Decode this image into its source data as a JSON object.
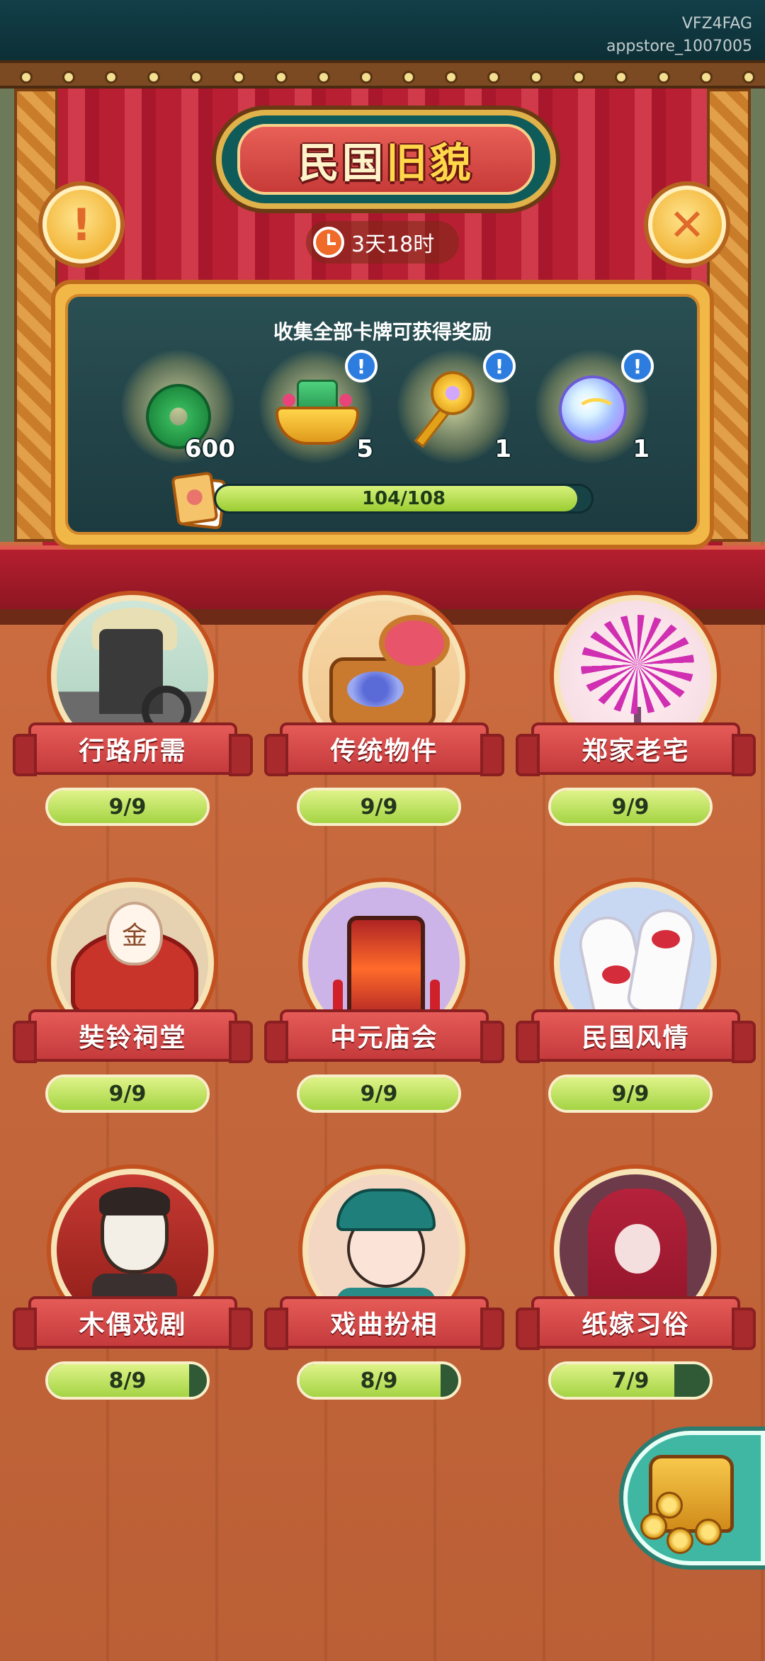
{
  "watermark": {
    "line1": "VFZ4FAG",
    "line2": "appstore_1007005"
  },
  "header": {
    "title_part1": "民国",
    "title_part2": "旧貌",
    "timer": "3天18时",
    "info_button_glyph": "!",
    "close_button_glyph": "✕"
  },
  "rewards": {
    "title": "收集全部卡牌可获得奖励",
    "items": [
      {
        "icon": "jade-coin-icon",
        "count": "600",
        "has_info": false
      },
      {
        "icon": "treasure-bowl-icon",
        "count": "5",
        "has_info": true
      },
      {
        "icon": "golden-mirror-icon",
        "count": "1",
        "has_info": true
      },
      {
        "icon": "magic-orb-icon",
        "count": "1",
        "has_info": true
      }
    ],
    "info_glyph": "!",
    "progress_text": "104/108",
    "progress_fraction": 0.963
  },
  "categories": [
    {
      "name": "行路所需",
      "progress": "9/9",
      "fraction": 1.0,
      "art": "rickshaw"
    },
    {
      "name": "传统物件",
      "progress": "9/9",
      "fraction": 1.0,
      "art": "box"
    },
    {
      "name": "郑家老宅",
      "progress": "9/9",
      "fraction": 1.0,
      "art": "flower"
    },
    {
      "name": "奘铃祠堂",
      "progress": "9/9",
      "fraction": 1.0,
      "art": "shrine"
    },
    {
      "name": "中元庙会",
      "progress": "9/9",
      "fraction": 1.0,
      "art": "lantern"
    },
    {
      "name": "民国风情",
      "progress": "9/9",
      "fraction": 1.0,
      "art": "gloves"
    },
    {
      "name": "木偶戏剧",
      "progress": "8/9",
      "fraction": 0.889,
      "art": "puppet"
    },
    {
      "name": "戏曲扮相",
      "progress": "8/9",
      "fraction": 0.889,
      "art": "opera"
    },
    {
      "name": "纸嫁习俗",
      "progress": "7/9",
      "fraction": 0.778,
      "art": "bride"
    }
  ],
  "shrine_glyph": "金",
  "colors": {
    "accent_red": "#c53a3c",
    "progress_green": "#a4d444",
    "panel_teal": "#1c3b40",
    "gold": "#f2b847"
  }
}
